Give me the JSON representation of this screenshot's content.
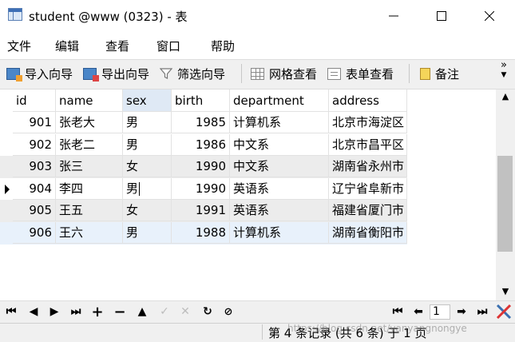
{
  "window": {
    "title": "student @www (0323) - 表"
  },
  "menu": [
    "文件",
    "编辑",
    "查看",
    "窗口",
    "帮助"
  ],
  "toolbar": {
    "import": "导入向导",
    "export": "导出向导",
    "filter": "筛选向导",
    "grid_view": "网格查看",
    "form_view": "表单查看",
    "note": "备注"
  },
  "table": {
    "columns": [
      "id",
      "name",
      "sex",
      "birth",
      "department",
      "address"
    ],
    "selected_column": "sex",
    "rows": [
      {
        "id": "901",
        "name": "张老大",
        "sex": "男",
        "birth": "1985",
        "department": "计算机系",
        "address": "北京市海淀区"
      },
      {
        "id": "902",
        "name": "张老二",
        "sex": "男",
        "birth": "1986",
        "department": "中文系",
        "address": "北京市昌平区"
      },
      {
        "id": "903",
        "name": "张三",
        "sex": "女",
        "birth": "1990",
        "department": "中文系",
        "address": "湖南省永州市"
      },
      {
        "id": "904",
        "name": "李四",
        "sex": "男",
        "birth": "1990",
        "department": "英语系",
        "address": "辽宁省阜新市"
      },
      {
        "id": "905",
        "name": "王五",
        "sex": "女",
        "birth": "1991",
        "department": "英语系",
        "address": "福建省厦门市"
      },
      {
        "id": "906",
        "name": "王六",
        "sex": "男",
        "birth": "1988",
        "department": "计算机系",
        "address": "湖南省衡阳市"
      }
    ],
    "current_row_index": 3
  },
  "nav": {
    "page": "1"
  },
  "status": {
    "text": "第 4 条记录 (共 6 条) 于 1 页"
  },
  "watermark": "https://blog.csdn.net/yanyangnongye",
  "colors": {
    "selected_header": "#dfe9f5",
    "striped_row": "#ececec",
    "last_row": "#e8f1fb",
    "chrome": "#f0f0f0"
  }
}
